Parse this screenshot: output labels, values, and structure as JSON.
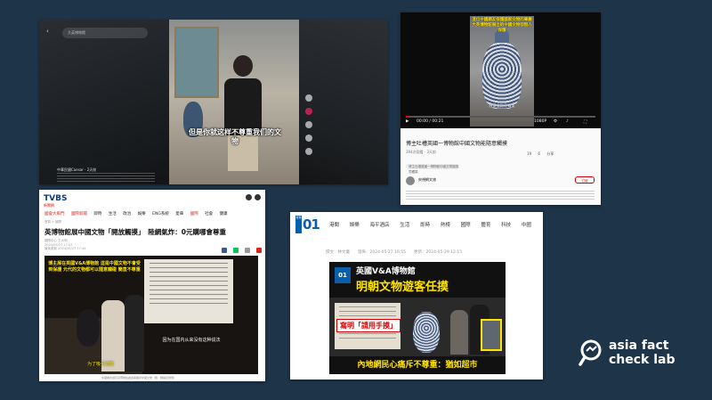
{
  "panel1": {
    "search_placeholder": "大英博物館",
    "subtitle": "但是你就这样不尊重我们的文物",
    "channel": "中華民國Caesar · 2天前",
    "back_icon": "back-arrow-icon",
    "side_icons": [
      "avatar-icon",
      "heart-icon",
      "comment-icon",
      "bookmark-icon",
      "share-icon"
    ]
  },
  "panel2": {
    "overlay_text": "這位中國網友保護國家文物的尊嚴 大英博物館展出的中國文物卻無人保護",
    "overlay_sub": "触摸宝贝 不尊重",
    "time": "00:00 / 00:21",
    "quality": "1080P",
    "progress": 0.02,
    "video_title": "博主吐槽英國一博物館中國文物能隨意觸摸",
    "views": "394次观看 · 3天前",
    "actions": [
      "19",
      "6",
      "分享"
    ],
    "tag": "博主吐槽英國一博物館中國文物能隨意觸摸",
    "channel": "央視網文旅",
    "subscribe": "订阅",
    "subscribe_color": "#cc0000"
  },
  "panel3": {
    "logo_main": "TVBS",
    "logo_sub": "新聞網",
    "nav": [
      "國會大風門",
      "國際新聞",
      "即時",
      "生活",
      "政治",
      "娛樂",
      "ENG系統",
      "愛車",
      "國際",
      "社會",
      "健康"
    ],
    "crumb": "首頁 > 國際",
    "headline": "英博物館展中國文物「開放觸摸」　陸網氣炸：0元購哪會尊重",
    "meta": [
      "國際中心 王大明",
      "2024/05/27 17:43",
      "最後更新 2024/05/27 17:44"
    ],
    "img_top": "博主展在英國V&A博物館 這是中國文物不會受到保護 元代的文物都可以隨意觸碰 簡直不尊重",
    "img_mid": "因为在国内从来没有这种说法",
    "img_bottom": "为了吸引游客",
    "caption": "中國網友抱怨英博物館讓遊客觸摸中國文物（圖／翻攝自微博）"
  },
  "panel4": {
    "logo_tag": "香港",
    "logo_num": "01",
    "nav": [
      "港聞",
      "娛樂",
      "海平酒店",
      "生活",
      "即時",
      "熱榜",
      "國際",
      "體育",
      "科技",
      "中國"
    ],
    "meta": "撰文：林文蕾　　發佈：2024-05-27 16:55　　更新：2024-05-29 12:15",
    "badge": "01",
    "head1": "英國V&A博物館",
    "head2": "明朝文物遊客任摸",
    "stamp": "寫明「請用手摸」",
    "bottom": "內地網民心痛斥不尊重：猶如超市"
  },
  "watermark": {
    "line1": "asia fact",
    "line2": "check lab"
  }
}
